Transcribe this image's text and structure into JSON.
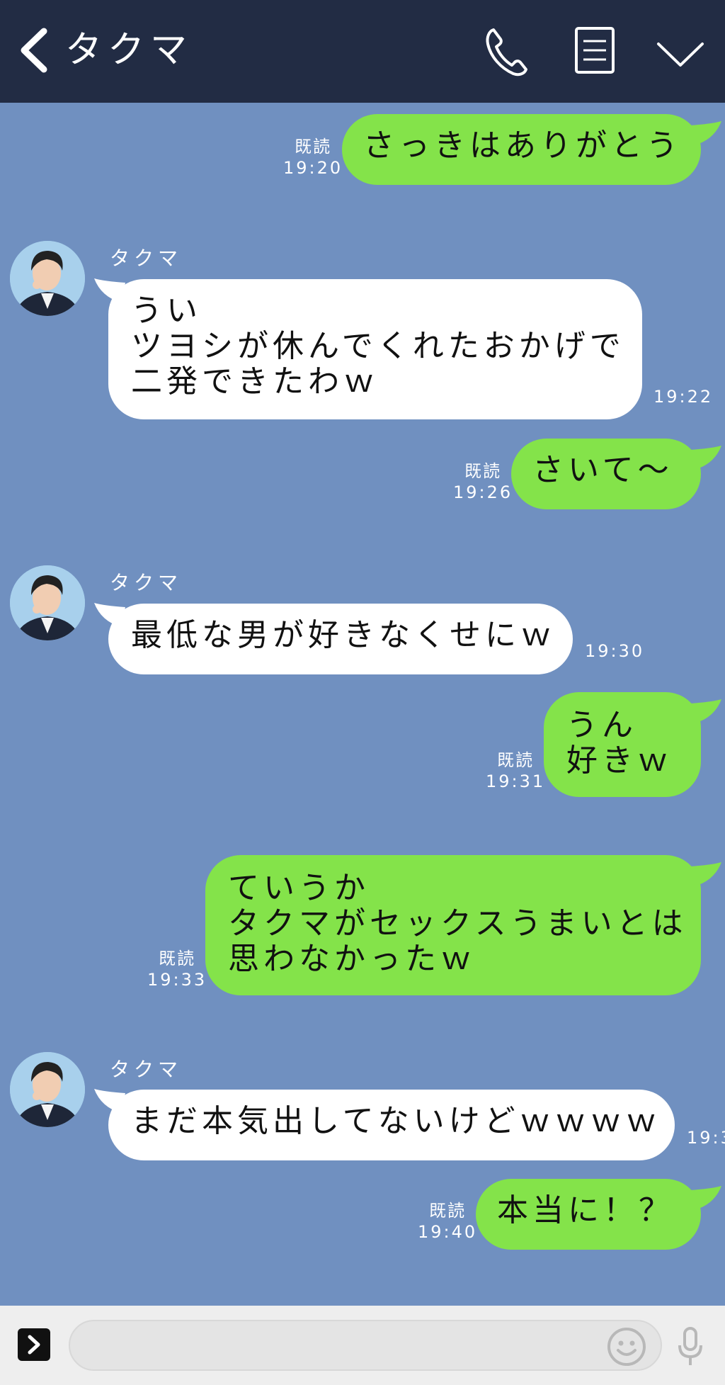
{
  "header": {
    "title": "タクマ",
    "back_icon": "chevron-left-icon",
    "icons": [
      "phone-icon",
      "notes-icon",
      "chevron-down-icon"
    ]
  },
  "messages": [
    {
      "dir": "sent",
      "lines": "さっきはありがとう",
      "read": "既読",
      "time": "19:20"
    },
    {
      "dir": "recv",
      "sender": "タクマ",
      "lines": "うい\nツヨシが休んでくれたおかげで\n二発できたわｗ",
      "time": "19:22"
    },
    {
      "dir": "sent",
      "lines": "さいて～",
      "read": "既読",
      "time": "19:26"
    },
    {
      "dir": "recv",
      "sender": "タクマ",
      "lines": "最低な男が好きなくせにｗ",
      "time": "19:30"
    },
    {
      "dir": "sent",
      "lines": "うん\n好きｗ",
      "read": "既読",
      "time": "19:31"
    },
    {
      "dir": "sent",
      "lines": "ていうか\nタクマがセックスうまいとは\n思わなかったｗ",
      "read": "既読",
      "time": "19:33"
    },
    {
      "dir": "recv",
      "sender": "タクマ",
      "lines": "まだ本気出してないけどｗｗｗｗ",
      "time": "19:3"
    },
    {
      "dir": "sent",
      "lines": "本当に！？",
      "read": "既読",
      "time": "19:40"
    }
  ],
  "footer": {
    "input_value": "",
    "icons": [
      "expand-icon",
      "emoji-icon",
      "mic-icon"
    ]
  },
  "colors": {
    "header_bg": "#222c44",
    "chat_bg": "#7090c0",
    "sent_bubble": "#84e34a",
    "recv_bubble": "#ffffff",
    "footer_bg": "#eeeeee"
  }
}
